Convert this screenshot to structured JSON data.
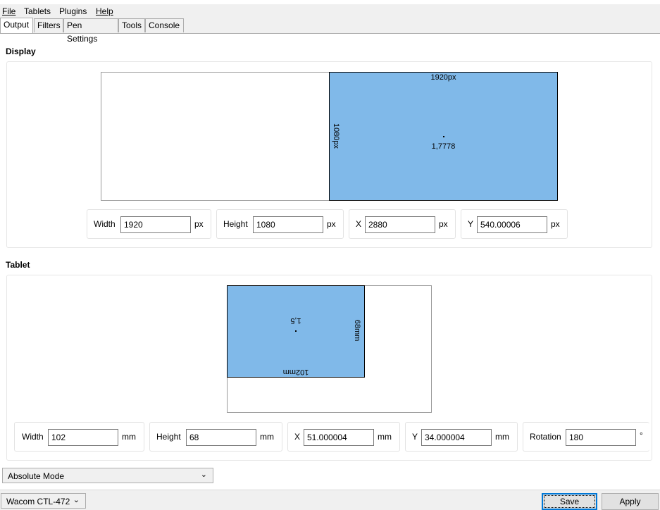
{
  "menu": {
    "file": "File",
    "tablets": "Tablets",
    "plugins": "Plugins",
    "help": "Help"
  },
  "tabs": [
    "Output",
    "Filters",
    "Pen Settings",
    "Tools",
    "Console"
  ],
  "active_tab": "Output",
  "display": {
    "title": "Display",
    "area_width_label": "1920px",
    "area_height_label": "1080px",
    "aspect_ratio": "1,7778",
    "fields": {
      "width_label": "Width",
      "width_value": "1920",
      "width_unit": "px",
      "height_label": "Height",
      "height_value": "1080",
      "height_unit": "px",
      "x_label": "X",
      "x_value": "2880",
      "x_unit": "px",
      "y_label": "Y",
      "y_value": "540.00006",
      "y_unit": "px"
    }
  },
  "tablet": {
    "title": "Tablet",
    "area_width_label": "102mm",
    "area_height_label": "68mm",
    "aspect_ratio": "1,5",
    "fields": {
      "width_label": "Width",
      "width_value": "102",
      "width_unit": "mm",
      "height_label": "Height",
      "height_value": "68",
      "height_unit": "mm",
      "x_label": "X",
      "x_value": "51.000004",
      "x_unit": "mm",
      "y_label": "Y",
      "y_value": "34.000004",
      "y_unit": "mm",
      "rotation_label": "Rotation",
      "rotation_value": "180",
      "rotation_unit": "°"
    }
  },
  "mode_select": {
    "value": "Absolute Mode"
  },
  "tablet_select": {
    "value": "Wacom CTL-472"
  },
  "buttons": {
    "save": "Save",
    "apply": "Apply"
  },
  "colors": {
    "area_fill": "#80b9e9",
    "chrome_bg": "#f0f0f0"
  }
}
